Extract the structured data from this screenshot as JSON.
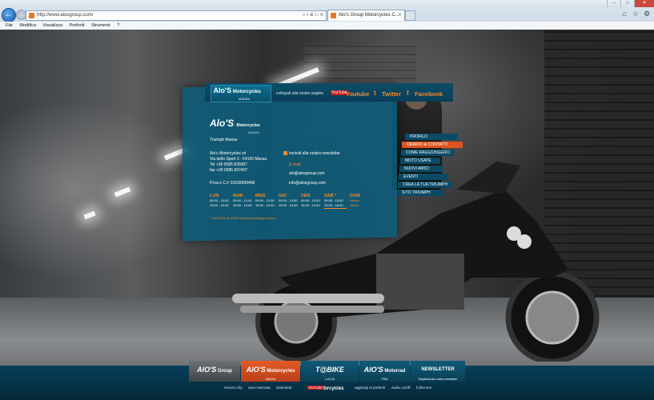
{
  "browser": {
    "url": "http://www.alosgroup.com/",
    "tab_title": "Alo's Group Motorcycles C...",
    "menu": [
      "File",
      "Modifica",
      "Visualizza",
      "Preferiti",
      "Strumenti",
      "?"
    ]
  },
  "header": {
    "connect_text": "collegati alla nostre pagine",
    "youtube_icon": "YouTube",
    "youtube": "Youtube",
    "twitter": "Twitter",
    "facebook": "Facebook"
  },
  "dealer": {
    "logo_main": "Alo'S",
    "logo_side": "Motorcycles",
    "logo_city": "MASSA",
    "brand": "Triumph Massa",
    "company": "Alo's Motorcycles srl",
    "address": "Via dello Sport 3 - 54100 Massa",
    "tel": "Tel +39 0585 830087",
    "fax": "fax +39 0585 837407",
    "piva": "P.Iva e C.F 01639590458",
    "newsletter": "Iscriviti alla nostra newsletter",
    "email_label": "E-mail:",
    "email1": "alo@alosgroup.com",
    "email2": "info@alosgroup.com"
  },
  "hours": {
    "days": [
      {
        "d": "LUN",
        "h1": "09.00 - 13.00",
        "h2": "15.00 - 19.00"
      },
      {
        "d": "MAR",
        "h1": "09.00 - 13.00",
        "h2": "15.00 - 19.00"
      },
      {
        "d": "MER",
        "h1": "09.00 - 13.00",
        "h2": "15.00 - 19.00"
      },
      {
        "d": "GIO",
        "h1": "09.00 - 13.00",
        "h2": "15.00 - 19.00"
      },
      {
        "d": "VEN",
        "h1": "09.00 - 13.00",
        "h2": "15.00 - 19.00"
      },
      {
        "d": "SAB *",
        "h1": "09.00 - 13.00",
        "h2": "15.00 - 18.00"
      },
      {
        "d": "DOM",
        "h1": "chiuso",
        "h2": "chiuso"
      }
    ],
    "note": "* Dal 20/06 al 20/09 Sabato pomeriggio chiuso"
  },
  "menu": [
    {
      "label": "PROFILO",
      "on": false
    },
    {
      "label": "ORARIO  ⊕  CONTATTI",
      "on": true
    },
    {
      "label": "COME RAGGIUNGERCI",
      "on": false
    },
    {
      "label": "MOTO USATE",
      "on": false
    },
    {
      "label": "NUOVI AMICI",
      "on": false
    },
    {
      "label": "EVENTI",
      "on": false
    },
    {
      "label": "CREA LA TUA TRIUMPH",
      "on": false
    },
    {
      "label": "SITO TRIUMPH",
      "on": false
    }
  ],
  "footer_nav": [
    {
      "big": "AlO'S",
      "small": "Group",
      "sub": ""
    },
    {
      "big": "AlO'S",
      "small": "Motorcycles",
      "sub": "MASSA"
    },
    {
      "big": "T@BIKE",
      "small": "Motorcycles",
      "sub": "LUCCA"
    },
    {
      "big": "AlO'S",
      "small": "Motorrad",
      "sub": "PISA"
    },
    {
      "big": "NEWSLETTER",
      "small": "",
      "sub": "Registrati alla nostra newsletter"
    }
  ],
  "footer_links": {
    "rinuovo": "rinuovo clip",
    "area": "area riservata",
    "download": "download",
    "yt": "YouTube",
    "fb": "f",
    "tw": "t",
    "preferiti": "aggiungi ai preferiti",
    "audio": "audio on/off",
    "fullscreen": "fullscreen"
  }
}
